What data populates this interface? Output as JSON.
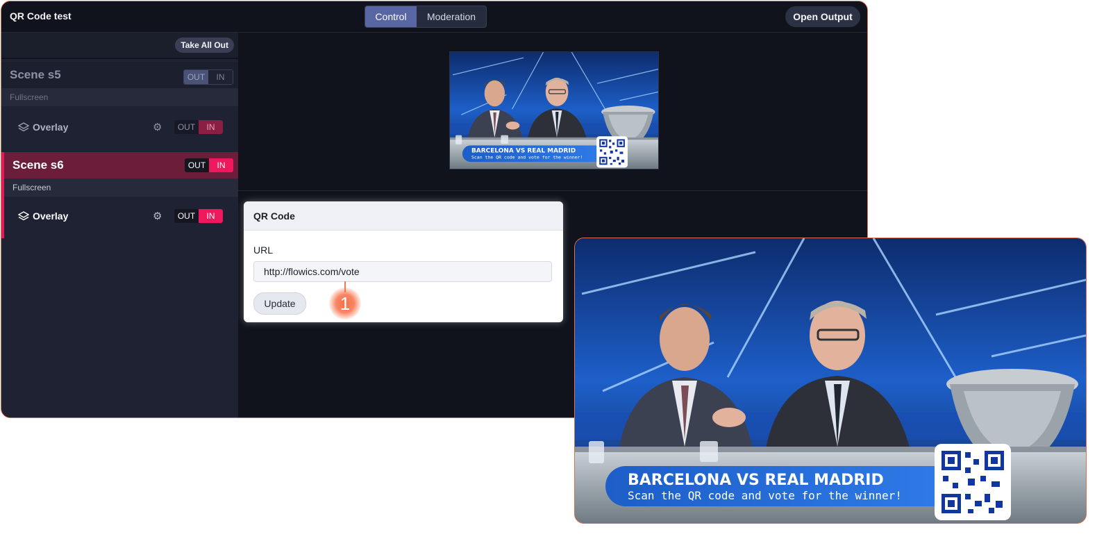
{
  "app": {
    "title": "QR Code test"
  },
  "tabs": [
    {
      "label": "Control",
      "active": true
    },
    {
      "label": "Moderation",
      "active": false
    }
  ],
  "header": {
    "open_output_label": "Open Output"
  },
  "sidebar": {
    "take_all_out_label": "Take All Out",
    "scenes": [
      {
        "name": "Scene s5",
        "subtitle": "Fullscreen",
        "state": "OUT",
        "toggle": {
          "out": "OUT",
          "in": "IN"
        },
        "layer": {
          "label": "Overlay",
          "toggle": {
            "out": "OUT",
            "in": "IN"
          },
          "state": "IN"
        }
      },
      {
        "name": "Scene s6",
        "subtitle": "Fullscreen",
        "state": "IN",
        "toggle": {
          "out": "OUT",
          "in": "IN"
        },
        "layer": {
          "label": "Overlay",
          "toggle": {
            "out": "OUT",
            "in": "IN"
          },
          "state": "IN"
        }
      }
    ]
  },
  "qr_panel": {
    "title": "QR Code",
    "url_label": "URL",
    "url_value": "http://flowics.com/vote",
    "update_label": "Update"
  },
  "annotation": {
    "marker": "1"
  },
  "graphic": {
    "headline": "BARCELONA VS REAL MADRID",
    "subline": "Scan the QR code and vote for the winner!"
  },
  "colors": {
    "accent_active": "#e3195a",
    "active_scene_bg": "#6c1d3a",
    "segment_active": "#5866a3",
    "annotation": "#f07a4f",
    "app_bg": "#10131c"
  },
  "icons": {
    "layer": "layers-icon",
    "settings": "gear-icon"
  }
}
